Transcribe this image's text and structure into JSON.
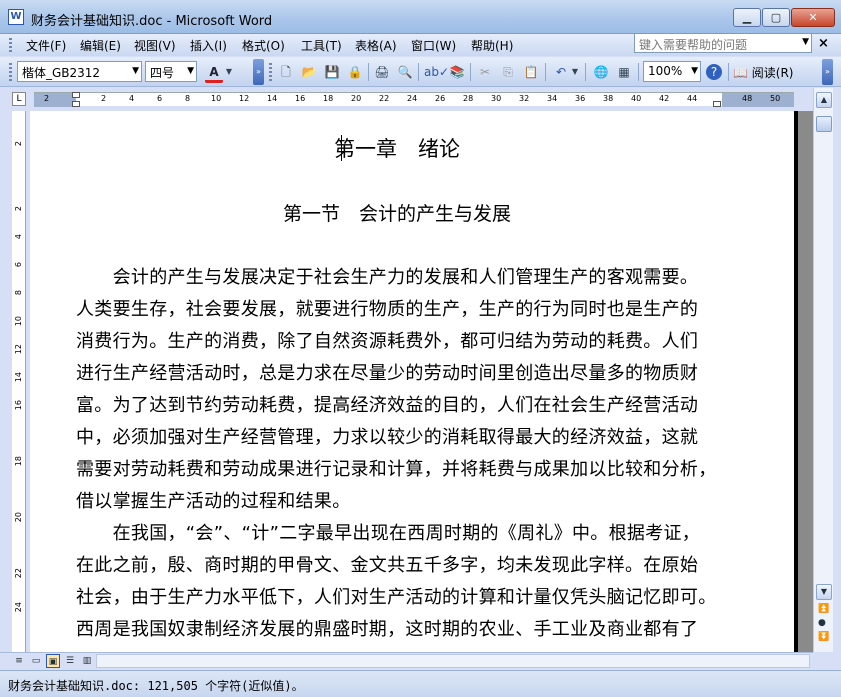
{
  "window": {
    "title": "财务会计基础知识.doc - Microsoft Word",
    "minimize_label": "▁",
    "maximize_label": "▢",
    "close_label": "✕"
  },
  "menu": {
    "items": [
      "文件(F)",
      "编辑(E)",
      "视图(V)",
      "插入(I)",
      "格式(O)",
      "工具(T)",
      "表格(A)",
      "窗口(W)",
      "帮助(H)"
    ],
    "help_search_placeholder": "键入需要帮助的问题",
    "doc_close_label": "×"
  },
  "toolbar": {
    "font_name": "楷体_GB2312",
    "font_size": "四号",
    "font_color_label": "A",
    "zoom": "100%",
    "read_button_label": "阅读(R)",
    "font_color_hex": "#e02020"
  },
  "ruler": {
    "numbers": [
      "2",
      "2",
      "4",
      "6",
      "8",
      "10",
      "12",
      "14",
      "16",
      "18",
      "20",
      "22",
      "24",
      "26",
      "28",
      "30",
      "32",
      "34",
      "36",
      "38",
      "40",
      "42",
      "44",
      "48",
      "50"
    ],
    "vertical_numbers": [
      "2",
      "2",
      "4",
      "6",
      "8",
      "10",
      "12",
      "14",
      "16",
      "18",
      "20",
      "22",
      "24"
    ]
  },
  "document": {
    "chapter_title": "第一章　绪论",
    "section_title": "第一节　会计的产生与发展",
    "lines": [
      "　　会计的产生与发展决定于社会生产力的发展和人们管理生产的客观需要。",
      "人类要生存，社会要发展，就要进行物质的生产，生产的行为同时也是生产的",
      "消费行为。生产的消费，除了自然资源耗费外，都可归结为劳动的耗费。人们",
      "进行生产经营活动时，总是力求在尽量少的劳动时间里创造出尽量多的物质财",
      "富。为了达到节约劳动耗费，提高经济效益的目的，人们在社会生产经营活动",
      "中，必须加强对生产经营管理，力求以较少的消耗取得最大的经济效益，这就",
      "需要对劳动耗费和劳动成果进行记录和计算，并将耗费与成果加以比较和分析，",
      "借以掌握生产活动的过程和结果。",
      "　　在我国，“会”、“计”二字最早出现在西周时期的《周礼》中。根据考证，",
      "在此之前，殷、商时期的甲骨文、金文共五千多字，均未发现此字样。在原始",
      "社会，由于生产力水平低下，人们对生产活动的计算和计量仅凭头脑记忆即可。",
      "西周是我国奴隶制经济发展的鼎盛时期，这时期的农业、手工业及商业都有了"
    ]
  },
  "status": {
    "text": "财务会计基础知识.doc: 121,505 个字符(近似值)。"
  }
}
